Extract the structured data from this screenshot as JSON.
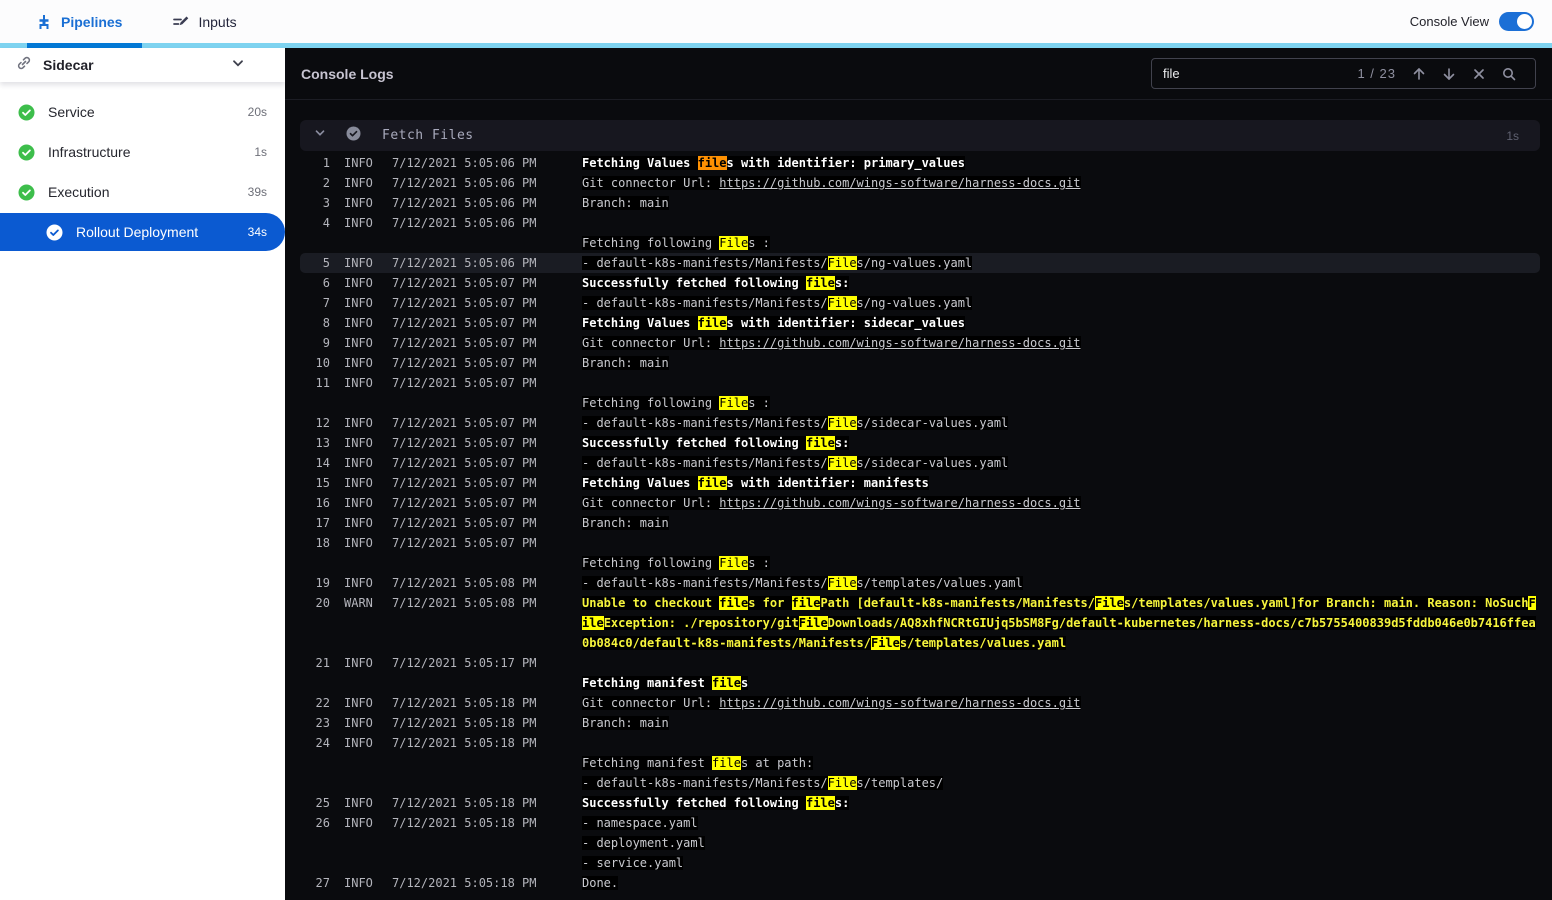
{
  "topbar": {
    "tabs": [
      {
        "label": "Pipelines",
        "active": true
      },
      {
        "label": "Inputs",
        "active": false
      }
    ],
    "console_view_label": "Console View",
    "console_view_on": true
  },
  "sidebar": {
    "title": "Sidecar",
    "items": [
      {
        "label": "Service",
        "duration": "20s",
        "status": "success",
        "selected": false
      },
      {
        "label": "Infrastructure",
        "duration": "1s",
        "status": "success",
        "selected": false
      },
      {
        "label": "Execution",
        "duration": "39s",
        "status": "success",
        "selected": false
      },
      {
        "label": "Rollout Deployment",
        "duration": "34s",
        "status": "success",
        "selected": true
      }
    ]
  },
  "console": {
    "title": "Console Logs",
    "search": {
      "value": "file",
      "counter": "1 / 23"
    },
    "group": {
      "title": "Fetch Files",
      "duration": "1s"
    },
    "highlighted_row": 5,
    "entries": [
      {
        "n": 1,
        "level": "INFO",
        "time": "7/12/2021 5:05:06 PM",
        "lines": [
          [
            {
              "t": "Fetching Values files with identifier: primary_values",
              "s": "bold"
            }
          ]
        ]
      },
      {
        "n": 2,
        "level": "INFO",
        "time": "7/12/2021 5:05:06 PM",
        "lines": [
          [
            {
              "t": "Git connector Url: ",
              "s": "plain"
            },
            {
              "t": "https://github.com/wings-software/harness-docs.git",
              "s": "link"
            }
          ]
        ]
      },
      {
        "n": 3,
        "level": "INFO",
        "time": "7/12/2021 5:05:06 PM",
        "lines": [
          [
            "Branch: main"
          ]
        ]
      },
      {
        "n": 4,
        "level": "INFO",
        "time": "7/12/2021 5:05:06 PM",
        "lines": [
          [
            ""
          ],
          [
            "Fetching following Files :"
          ]
        ]
      },
      {
        "n": 5,
        "level": "INFO",
        "time": "7/12/2021 5:05:06 PM",
        "lines": [
          [
            "- default-k8s-manifests/Manifests/Files/ng-values.yaml"
          ]
        ]
      },
      {
        "n": 6,
        "level": "INFO",
        "time": "7/12/2021 5:05:07 PM",
        "lines": [
          [
            {
              "t": "Successfully fetched following files:",
              "s": "bold"
            }
          ]
        ]
      },
      {
        "n": 7,
        "level": "INFO",
        "time": "7/12/2021 5:05:07 PM",
        "lines": [
          [
            "- default-k8s-manifests/Manifests/Files/ng-values.yaml"
          ]
        ]
      },
      {
        "n": 8,
        "level": "INFO",
        "time": "7/12/2021 5:05:07 PM",
        "lines": [
          [
            {
              "t": "Fetching Values files with identifier: sidecar_values",
              "s": "bold"
            }
          ]
        ]
      },
      {
        "n": 9,
        "level": "INFO",
        "time": "7/12/2021 5:05:07 PM",
        "lines": [
          [
            {
              "t": "Git connector Url: ",
              "s": "plain"
            },
            {
              "t": "https://github.com/wings-software/harness-docs.git",
              "s": "link"
            }
          ]
        ]
      },
      {
        "n": 10,
        "level": "INFO",
        "time": "7/12/2021 5:05:07 PM",
        "lines": [
          [
            "Branch: main"
          ]
        ]
      },
      {
        "n": 11,
        "level": "INFO",
        "time": "7/12/2021 5:05:07 PM",
        "lines": [
          [
            ""
          ],
          [
            "Fetching following Files :"
          ]
        ]
      },
      {
        "n": 12,
        "level": "INFO",
        "time": "7/12/2021 5:05:07 PM",
        "lines": [
          [
            "- default-k8s-manifests/Manifests/Files/sidecar-values.yaml"
          ]
        ]
      },
      {
        "n": 13,
        "level": "INFO",
        "time": "7/12/2021 5:05:07 PM",
        "lines": [
          [
            {
              "t": "Successfully fetched following files:",
              "s": "bold"
            }
          ]
        ]
      },
      {
        "n": 14,
        "level": "INFO",
        "time": "7/12/2021 5:05:07 PM",
        "lines": [
          [
            "- default-k8s-manifests/Manifests/Files/sidecar-values.yaml"
          ]
        ]
      },
      {
        "n": 15,
        "level": "INFO",
        "time": "7/12/2021 5:05:07 PM",
        "lines": [
          [
            {
              "t": "Fetching Values files with identifier: manifests",
              "s": "bold"
            }
          ]
        ]
      },
      {
        "n": 16,
        "level": "INFO",
        "time": "7/12/2021 5:05:07 PM",
        "lines": [
          [
            {
              "t": "Git connector Url: ",
              "s": "plain"
            },
            {
              "t": "https://github.com/wings-software/harness-docs.git",
              "s": "link"
            }
          ]
        ]
      },
      {
        "n": 17,
        "level": "INFO",
        "time": "7/12/2021 5:05:07 PM",
        "lines": [
          [
            "Branch: main"
          ]
        ]
      },
      {
        "n": 18,
        "level": "INFO",
        "time": "7/12/2021 5:05:07 PM",
        "lines": [
          [
            ""
          ],
          [
            "Fetching following Files :"
          ]
        ]
      },
      {
        "n": 19,
        "level": "INFO",
        "time": "7/12/2021 5:05:08 PM",
        "lines": [
          [
            "- default-k8s-manifests/Manifests/Files/templates/values.yaml"
          ]
        ]
      },
      {
        "n": 20,
        "level": "WARN",
        "time": "7/12/2021 5:05:08 PM",
        "lines": [
          [
            {
              "t": "Unable to checkout files for filePath [default-k8s-manifests/Manifests/Files/templates/values.yaml]for Branch: main. Reason: NoSuchFileException: ./repository/gitFileDownloads/AQ8xhfNCRtGIUjq5bSM8Fg/default-kubernetes/harness-docs/c7b5755400839d5fddb046e0b7416ffea0b084c0/default-k8s-manifests/Manifests/Files/templates/values.yaml",
              "s": "warn"
            }
          ]
        ]
      },
      {
        "n": 21,
        "level": "INFO",
        "time": "7/12/2021 5:05:17 PM",
        "lines": [
          [
            ""
          ],
          [
            {
              "t": "Fetching manifest files",
              "s": "bold"
            }
          ]
        ]
      },
      {
        "n": 22,
        "level": "INFO",
        "time": "7/12/2021 5:05:18 PM",
        "lines": [
          [
            {
              "t": "Git connector Url: ",
              "s": "plain"
            },
            {
              "t": "https://github.com/wings-software/harness-docs.git",
              "s": "link"
            }
          ]
        ]
      },
      {
        "n": 23,
        "level": "INFO",
        "time": "7/12/2021 5:05:18 PM",
        "lines": [
          [
            "Branch: main"
          ]
        ]
      },
      {
        "n": 24,
        "level": "INFO",
        "time": "7/12/2021 5:05:18 PM",
        "lines": [
          [
            ""
          ],
          [
            "Fetching manifest files at path:"
          ],
          [
            "- default-k8s-manifests/Manifests/Files/templates/"
          ]
        ]
      },
      {
        "n": 25,
        "level": "INFO",
        "time": "7/12/2021 5:05:18 PM",
        "lines": [
          [
            {
              "t": "Successfully fetched following files:",
              "s": "bold"
            }
          ]
        ]
      },
      {
        "n": 26,
        "level": "INFO",
        "time": "7/12/2021 5:05:18 PM",
        "lines": [
          [
            "- namespace.yaml"
          ],
          [
            "- deployment.yaml"
          ],
          [
            "- service.yaml"
          ]
        ]
      },
      {
        "n": 27,
        "level": "INFO",
        "time": "7/12/2021 5:05:18 PM",
        "lines": [
          [
            "Done."
          ]
        ]
      }
    ]
  },
  "colors": {
    "accent_blue": "#0278d5",
    "selected_blue": "#0b5ad1",
    "success_green": "#3dbe4b",
    "topbar_accent_cyan": "#7ed3f0",
    "warn_text_yellow": "#f6f43c",
    "match_highlight": "#ffff00",
    "current_match_highlight": "#ff9102"
  },
  "icons": {
    "pipeline_icon": "pipeline",
    "inputs_icon": "input-set",
    "sidecar_icon": "link",
    "status_icon": "check-circle",
    "group_icon": "shield-check",
    "search_icons": [
      "arrow-up",
      "arrow-down",
      "close",
      "search"
    ]
  }
}
